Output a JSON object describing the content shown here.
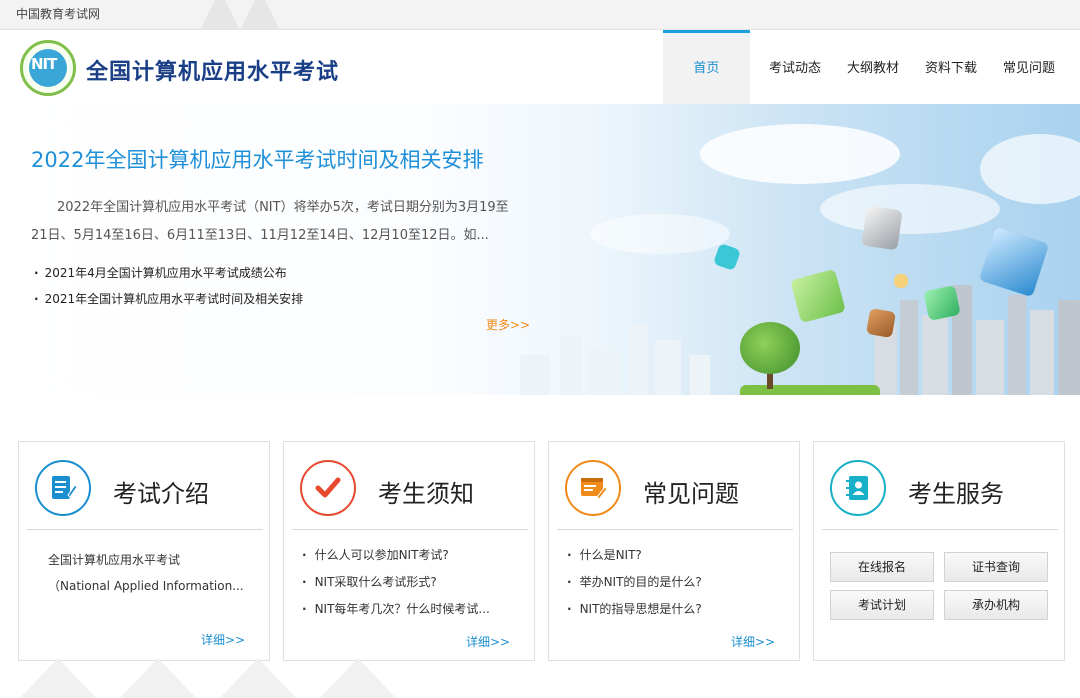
{
  "topbar": {
    "site_name": "中国教育考试网"
  },
  "header": {
    "logo_mark": "NIT",
    "title": "全国计算机应用水平考试",
    "nav": [
      {
        "label": "首页",
        "active": true
      },
      {
        "label": "考试动态",
        "active": false
      },
      {
        "label": "大纲教材",
        "active": false
      },
      {
        "label": "资料下载",
        "active": false
      },
      {
        "label": "常见问题",
        "active": false
      }
    ]
  },
  "banner": {
    "title": "2022年全国计算机应用水平考试时间及相关安排",
    "desc": "2022年全国计算机应用水平考试（NIT）将举办5次，考试日期分别为3月19至21日、5月14至16日、6月11至13日、11月12至14日、12月10至12日。如...",
    "news": [
      "2021年4月全国计算机应用水平考试成绩公布",
      "2021年全国计算机应用水平考试时间及相关安排"
    ],
    "more": "更多>>"
  },
  "cards": {
    "intro": {
      "title": "考试介绍",
      "icon": "document-edit-icon",
      "accent": "#1a8fd0",
      "line1": "全国计算机应用水平考试",
      "line2": "（National Applied Information...",
      "detail": "详细>>"
    },
    "notice": {
      "title": "考生须知",
      "icon": "checkmark-icon",
      "accent": "#e8492d",
      "items": [
        "什么人可以参加NIT考试?",
        "NIT采取什么考试形式?",
        "NIT每年考几次？什么时候考试..."
      ],
      "detail": "详细>>"
    },
    "faq": {
      "title": "常见问题",
      "icon": "browser-edit-icon",
      "accent": "#f08a1a",
      "items": [
        "什么是NIT?",
        "举办NIT的目的是什么?",
        "NIT的指导思想是什么?"
      ],
      "detail": "详细>>"
    },
    "service": {
      "title": "考生服务",
      "icon": "contact-book-icon",
      "accent": "#18b0c8",
      "buttons": [
        "在线报名",
        "证书查询",
        "考试计划",
        "承办机构"
      ]
    }
  }
}
